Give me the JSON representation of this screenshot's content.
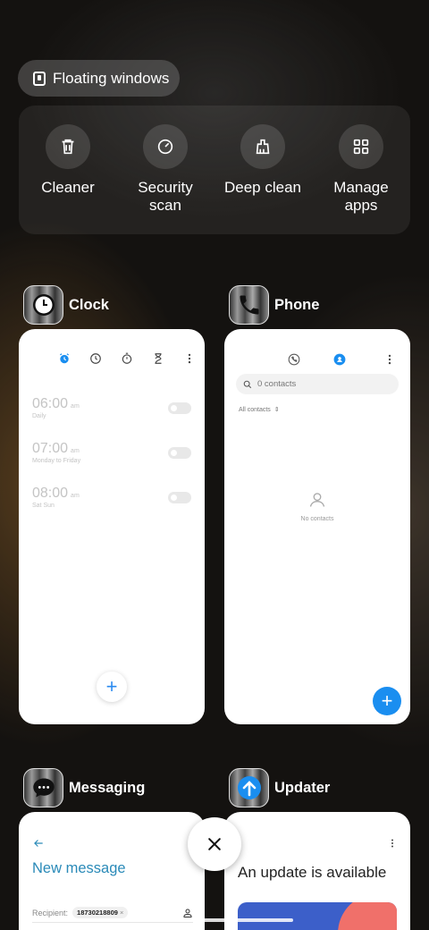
{
  "floating_windows": {
    "label": "Floating windows",
    "icon": "floating-window-icon"
  },
  "quick_actions": [
    {
      "label": "Cleaner",
      "icon": "trash-icon"
    },
    {
      "label": "Security\nscan",
      "icon": "security-scan-icon"
    },
    {
      "label": "Deep clean",
      "icon": "deep-clean-icon"
    },
    {
      "label": "Manage\napps",
      "icon": "grid-icon"
    }
  ],
  "apps": {
    "clock": {
      "name": "Clock",
      "alarms": [
        {
          "time": "06:00",
          "ampm": "am",
          "repeat": "Daily"
        },
        {
          "time": "07:00",
          "ampm": "am",
          "repeat": "Monday to Friday"
        },
        {
          "time": "08:00",
          "ampm": "am",
          "repeat": "Sat Sun"
        }
      ],
      "fab": "+"
    },
    "phone": {
      "name": "Phone",
      "search_placeholder": "0 contacts",
      "filter": "All contacts",
      "empty_text": "No contacts",
      "fab": "+"
    },
    "messaging": {
      "name": "Messaging",
      "title": "New message",
      "recipient_label": "Recipient:",
      "recipient_chip": "18730218809",
      "chip_remove": "×"
    },
    "updater": {
      "name": "Updater",
      "title": "An update is available"
    }
  },
  "close_button": "×",
  "colors": {
    "accent_blue": "#1a8ef0",
    "messaging_teal": "#2a8ab8",
    "updater_banner": "#3c5fc9",
    "updater_accent": "#f0706a"
  }
}
